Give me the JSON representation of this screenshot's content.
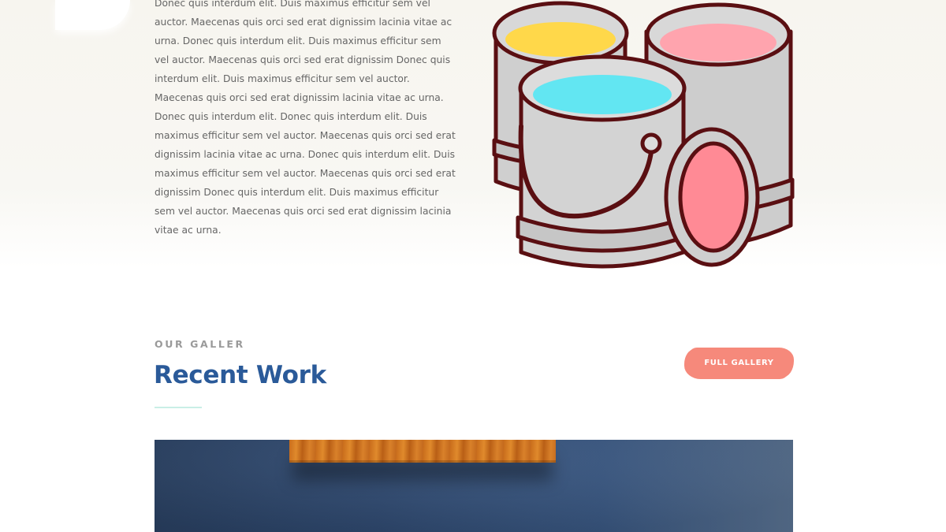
{
  "intro": {
    "paragraph": "Donec quis interdum elit. Duis maximus efficitur sem vel auctor. Maecenas quis orci sed erat dignissim lacinia vitae ac urna. Donec quis interdum elit. Duis maximus efficitur sem vel auctor. Maecenas quis orci sed erat dignissim Donec quis interdum elit. Duis maximus efficitur sem vel auctor. Maecenas quis orci sed erat dignissim lacinia vitae ac urna. Donec quis interdum elit. Donec quis interdum elit. Duis maximus efficitur sem vel auctor. Maecenas quis orci sed erat dignissim lacinia vitae ac urna. Donec quis interdum elit. Duis maximus efficitur sem vel auctor. Maecenas quis orci sed erat dignissim Donec quis interdum elit. Duis maximus efficitur sem vel auctor. Maecenas quis orci sed erat dignissim lacinia vitae ac urna."
  },
  "illustration": {
    "icon": "paint-buckets-icon",
    "paint_colors": [
      "#ffd84a",
      "#ffa4ae",
      "#62e6f2"
    ],
    "can_color": "#d3d3d3",
    "outline_color": "#5a0f12"
  },
  "gallery": {
    "eyebrow": "OUR GALLER",
    "title": "Recent Work",
    "button_label": "FULL GALLERY",
    "accent": "#f6897b",
    "title_color": "#2a5a99"
  }
}
